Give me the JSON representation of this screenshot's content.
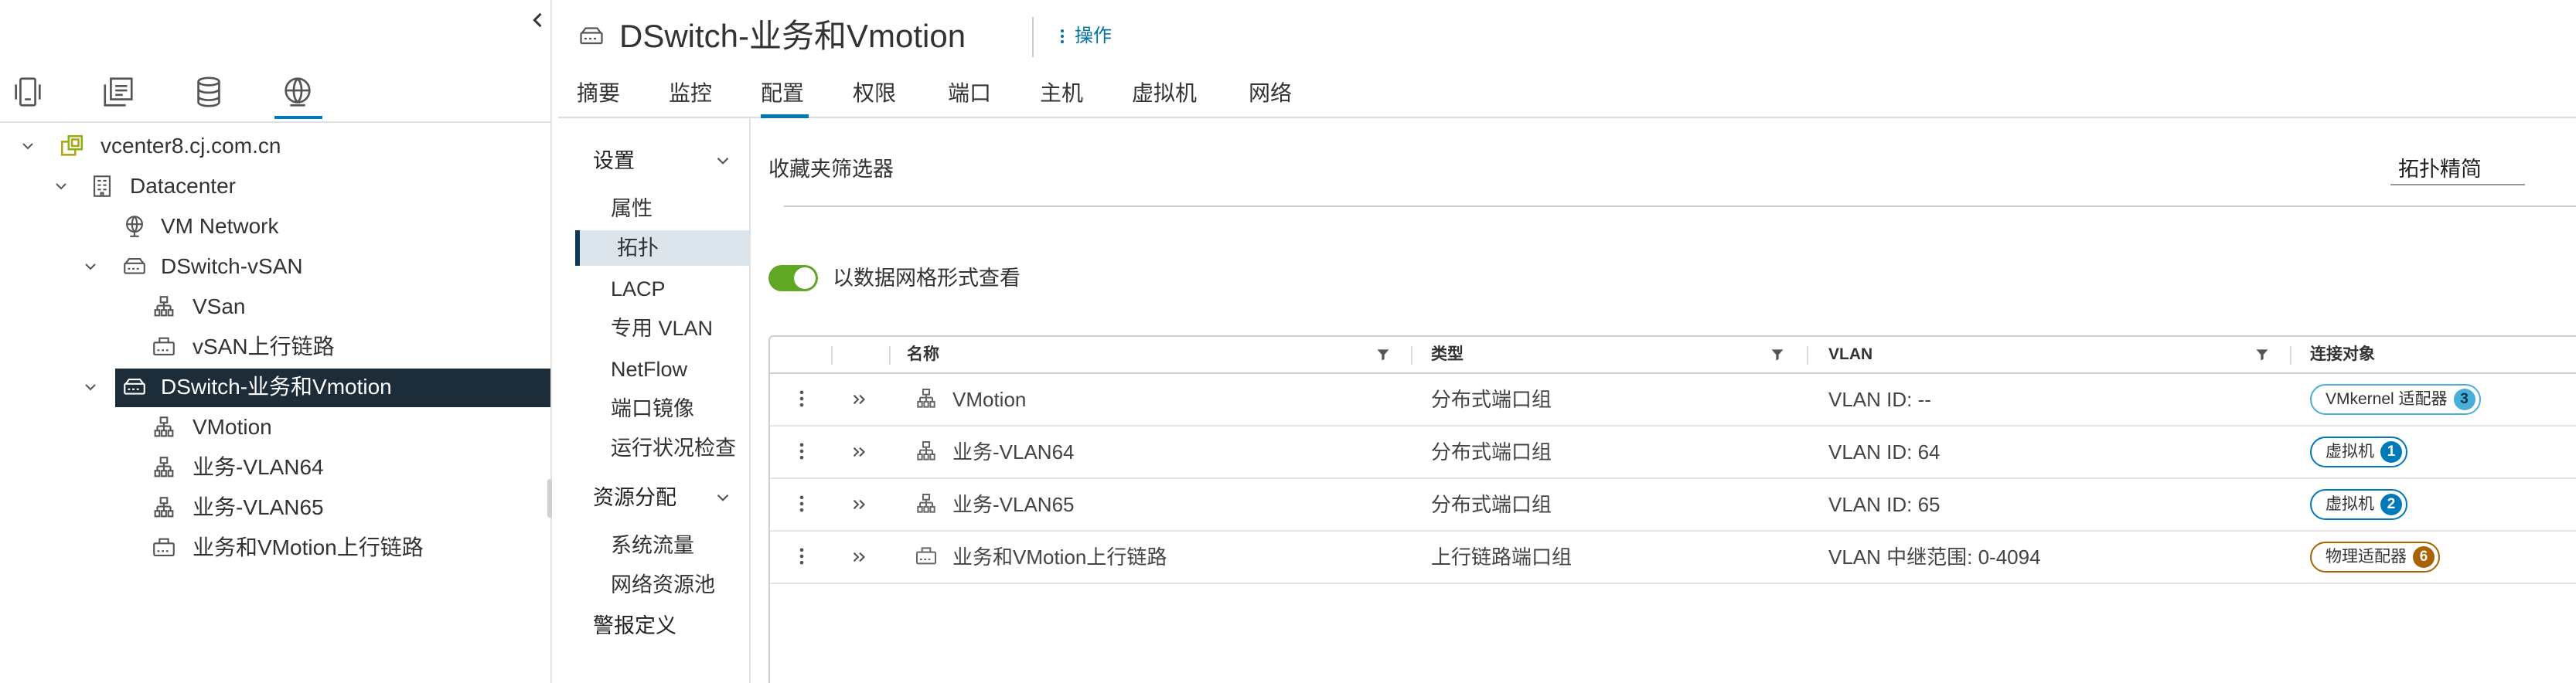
{
  "left_panel": {
    "collapse_icon": "chevron-left-icon",
    "view_tabs": [
      {
        "icon": "hosts-clusters-icon",
        "active": false
      },
      {
        "icon": "vms-templates-icon",
        "active": false
      },
      {
        "icon": "storage-icon",
        "active": false
      },
      {
        "icon": "networking-icon",
        "active": true
      }
    ],
    "tree": [
      {
        "label": "vcenter8.cj.com.cn",
        "level": 0,
        "expanded": true,
        "icon": "vcenter-icon"
      },
      {
        "label": "Datacenter",
        "level": 1,
        "expanded": true,
        "icon": "datacenter-icon"
      },
      {
        "label": "VM Network",
        "level": 2,
        "icon": "vm-network-icon"
      },
      {
        "label": "DSwitch-vSAN",
        "level": 2,
        "expanded": true,
        "icon": "distributed-switch-icon"
      },
      {
        "label": "VSan",
        "level": 3,
        "icon": "port-group-icon"
      },
      {
        "label": "vSAN上行链路",
        "level": 3,
        "icon": "uplink-port-group-icon"
      },
      {
        "label": "DSwitch-业务和Vmotion",
        "level": 2,
        "expanded": true,
        "selected": true,
        "icon": "distributed-switch-icon"
      },
      {
        "label": "VMotion",
        "level": 3,
        "icon": "port-group-icon"
      },
      {
        "label": "业务-VLAN64",
        "level": 3,
        "icon": "port-group-icon"
      },
      {
        "label": "业务-VLAN65",
        "level": 3,
        "icon": "port-group-icon"
      },
      {
        "label": "业务和VMotion上行链路",
        "level": 3,
        "icon": "uplink-port-group-icon"
      }
    ]
  },
  "header": {
    "icon": "distributed-switch-icon",
    "title": "DSwitch-业务和Vmotion",
    "actions_icon": "vertical-ellipsis-icon",
    "actions_label": "操作"
  },
  "tabs": [
    {
      "label": "摘要"
    },
    {
      "label": "监控"
    },
    {
      "label": "配置",
      "active": true
    },
    {
      "label": "权限"
    },
    {
      "label": "端口"
    },
    {
      "label": "主机"
    },
    {
      "label": "虚拟机"
    },
    {
      "label": "网络"
    }
  ],
  "config_nav": {
    "sections": [
      {
        "label": "设置",
        "expanded": true,
        "items": [
          {
            "label": "属性"
          },
          {
            "label": "拓扑",
            "selected": true
          },
          {
            "label": "LACP"
          },
          {
            "label": "专用 VLAN"
          },
          {
            "label": "NetFlow"
          },
          {
            "label": "端口镜像"
          },
          {
            "label": "运行状况检查"
          }
        ]
      },
      {
        "label": "资源分配",
        "expanded": true,
        "items": [
          {
            "label": "系统流量"
          },
          {
            "label": "网络资源池"
          }
        ]
      },
      {
        "label": "警报定义",
        "items": []
      }
    ]
  },
  "content": {
    "favorites_filter_label": "收藏夹筛选器",
    "view_select_value": "拓扑精简",
    "grid_toggle": {
      "label": "以数据网格形式查看",
      "on": true
    }
  },
  "table": {
    "columns": [
      {
        "label": "名称",
        "filter": true
      },
      {
        "label": "类型",
        "filter": true
      },
      {
        "label": "VLAN",
        "filter": true
      },
      {
        "label": "连接对象",
        "filter": false
      }
    ],
    "rows": [
      {
        "icon": "port-group-icon",
        "name": "VMotion",
        "type": "分布式端口组",
        "vlan": "VLAN ID: --",
        "connected": {
          "label": "VMkernel 适配器",
          "count": 3,
          "color": "#49afd9",
          "count_text_color": "#00364d"
        }
      },
      {
        "icon": "port-group-icon",
        "name": "业务-VLAN64",
        "type": "分布式端口组",
        "vlan": "VLAN ID: 64",
        "connected": {
          "label": "虚拟机",
          "count": 1,
          "color": "#0079b8",
          "count_text_color": "#ffffff"
        }
      },
      {
        "icon": "port-group-icon",
        "name": "业务-VLAN65",
        "type": "分布式端口组",
        "vlan": "VLAN ID: 65",
        "connected": {
          "label": "虚拟机",
          "count": 2,
          "color": "#0079b8",
          "count_text_color": "#ffffff"
        }
      },
      {
        "icon": "uplink-port-group-icon",
        "name": "业务和VMotion上行链路",
        "type": "上行链路端口组",
        "vlan": "VLAN 中继范围: 0-4094",
        "connected": {
          "label": "物理适配器",
          "count": 6,
          "color": "#aa6100",
          "count_text_color": "#ffffff"
        }
      }
    ]
  },
  "colors": {
    "accent": "#0079b8",
    "link": "#0072a3",
    "tree_selected_bg": "#1c2c38",
    "toggle_on": "#60a723"
  }
}
